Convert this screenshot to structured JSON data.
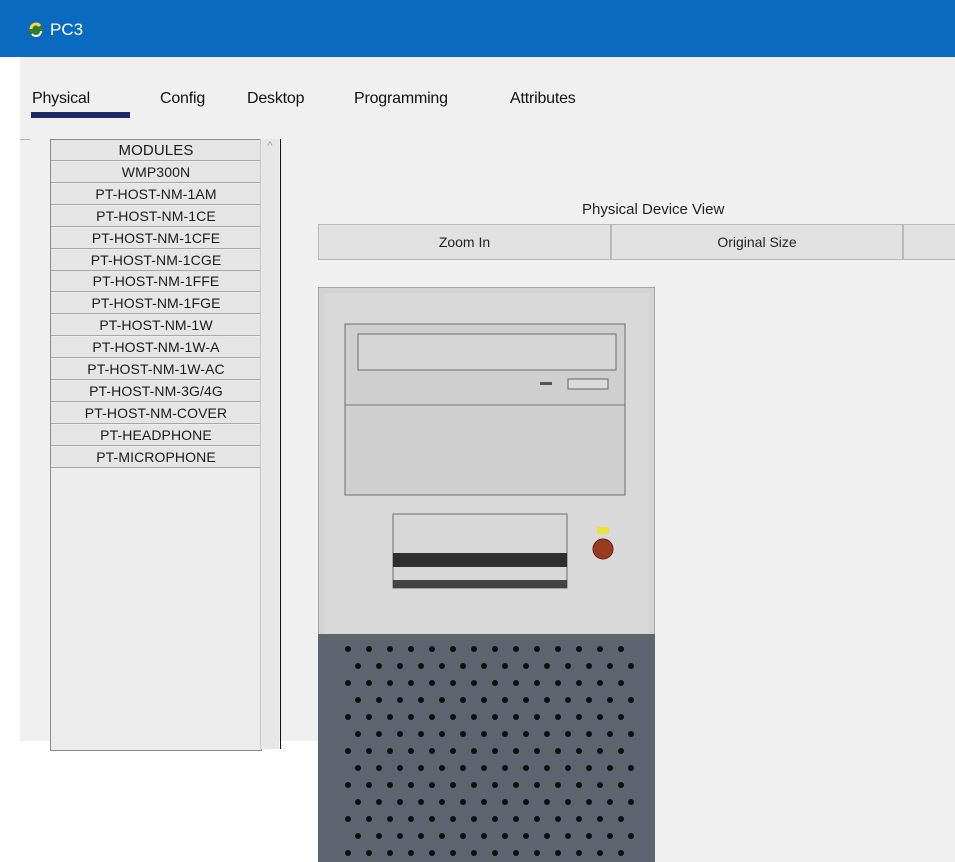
{
  "window": {
    "title": "PC3"
  },
  "tabs": [
    {
      "label": "Physical",
      "active": true
    },
    {
      "label": "Config",
      "active": false
    },
    {
      "label": "Desktop",
      "active": false
    },
    {
      "label": "Programming",
      "active": false
    },
    {
      "label": "Attributes",
      "active": false
    }
  ],
  "modules": {
    "items": [
      "MODULES",
      "WMP300N",
      "PT-HOST-NM-1AM",
      "PT-HOST-NM-1CE",
      "PT-HOST-NM-1CFE",
      "PT-HOST-NM-1CGE",
      "PT-HOST-NM-1FFE",
      "PT-HOST-NM-1FGE",
      "PT-HOST-NM-1W",
      "PT-HOST-NM-1W-A",
      "PT-HOST-NM-1W-AC",
      "PT-HOST-NM-3G/4G",
      "PT-HOST-NM-COVER",
      "PT-HEADPHONE",
      "PT-MICROPHONE"
    ]
  },
  "device_view": {
    "title": "Physical Device View",
    "toolbar": {
      "zoom_in": "Zoom In",
      "original_size": "Original Size",
      "zoom_out": ""
    }
  },
  "colors": {
    "titlebar": "#0a6abf",
    "active_tab_underline": "#1b2a63"
  }
}
